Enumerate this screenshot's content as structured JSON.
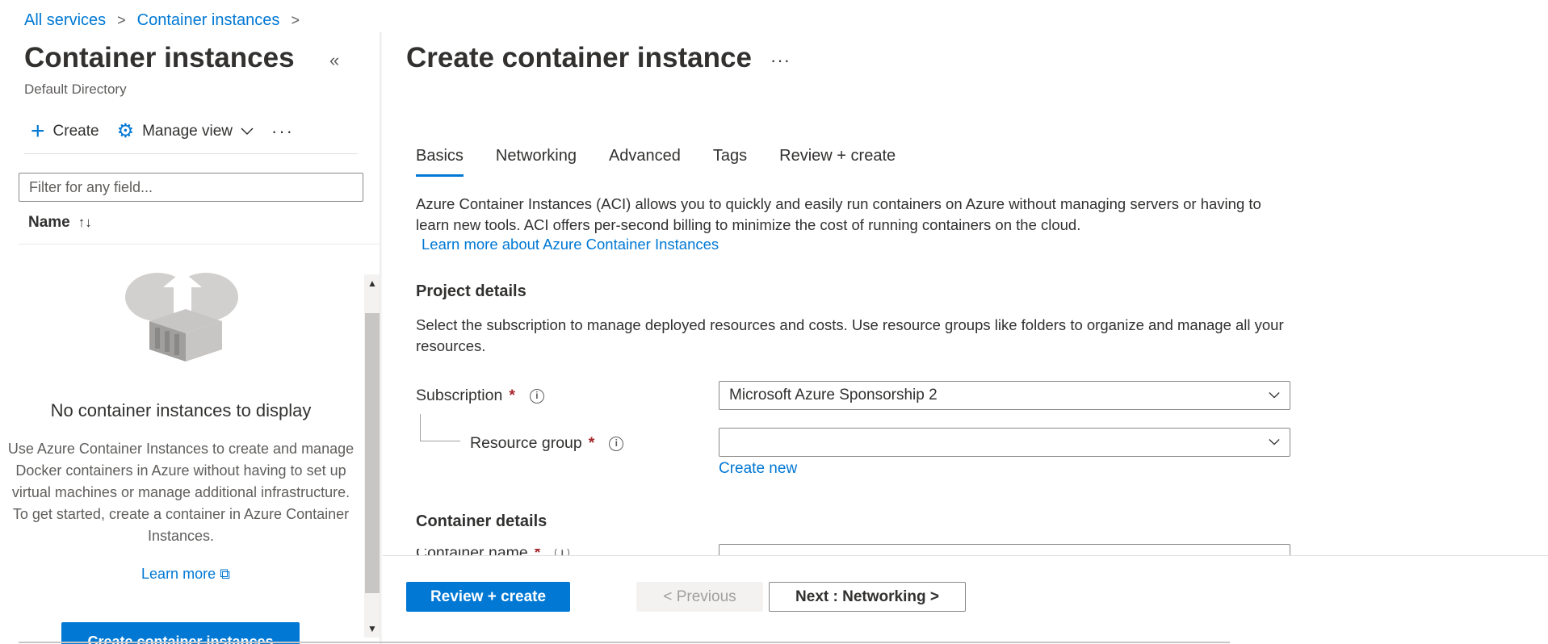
{
  "breadcrumb": {
    "items": [
      "All services",
      "Container instances"
    ],
    "separator": ">"
  },
  "left_pane": {
    "title": "Container instances",
    "subtitle": "Default Directory",
    "collapse_icon": "«",
    "toolbar": {
      "create_label": "Create",
      "manage_view_label": "Manage view",
      "more_label": "···"
    },
    "filter_placeholder": "Filter for any field...",
    "column_name": "Name",
    "sort_icon": "↑↓",
    "empty_state": {
      "title": "No container instances to display",
      "description": "Use Azure Container Instances to create and manage Docker containers in Azure without having to set up virtual machines or manage additional infrastructure. To get started, create a container in Azure Container Instances.",
      "learn_more": "Learn more",
      "button_label": "Create container instances"
    }
  },
  "right_pane": {
    "title": "Create container instance",
    "more_label": "···",
    "tabs": [
      {
        "label": "Basics",
        "active": true
      },
      {
        "label": "Networking",
        "active": false
      },
      {
        "label": "Advanced",
        "active": false
      },
      {
        "label": "Tags",
        "active": false
      },
      {
        "label": "Review + create",
        "active": false
      }
    ],
    "intro_text": "Azure Container Instances (ACI) allows you to quickly and easily run containers on Azure without managing servers or having to learn new tools. ACI offers per-second billing to minimize the cost of running containers on the cloud.",
    "intro_link": "Learn more about Azure Container Instances",
    "project_details": {
      "heading": "Project details",
      "description": "Select the subscription to manage deployed resources and costs. Use resource groups like folders to organize and manage all your resources.",
      "subscription_label": "Subscription",
      "subscription_value": "Microsoft Azure Sponsorship 2",
      "resource_group_label": "Resource group",
      "resource_group_value": "",
      "create_new": "Create new"
    },
    "container_details": {
      "heading": "Container details",
      "container_name_label": "Container name"
    },
    "required_mark": "*",
    "info_icon": "i",
    "footer": {
      "review_create": "Review + create",
      "previous": "< Previous",
      "next": "Next : Networking >"
    }
  },
  "colors": {
    "accent": "#0078d4",
    "required": "#a4262c",
    "text": "#323130",
    "muted": "#605e5c"
  }
}
